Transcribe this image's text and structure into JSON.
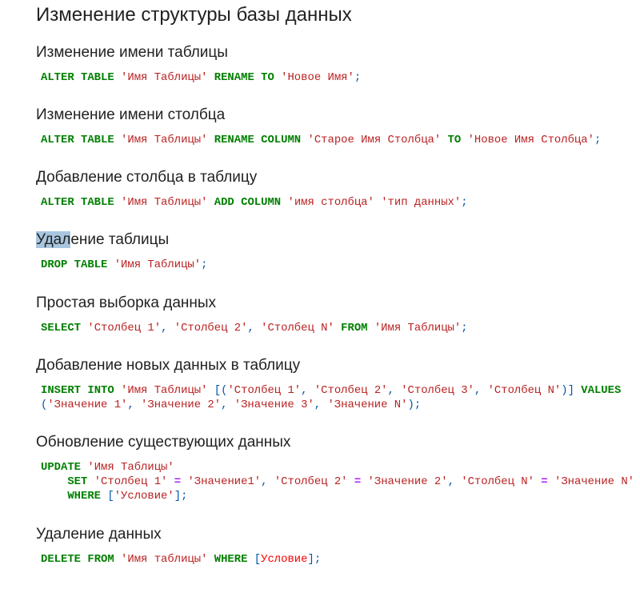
{
  "title": "Изменение структуры базы данных",
  "sections": [
    {
      "heading": "Изменение имени таблицы",
      "code": [
        [
          [
            "k",
            "ALTER TABLE"
          ],
          [
            "p",
            " "
          ],
          [
            "s",
            "'Имя Таблицы'"
          ],
          [
            "p",
            " "
          ],
          [
            "k",
            "RENAME"
          ],
          [
            "p",
            " "
          ],
          [
            "k",
            "TO"
          ],
          [
            "p",
            " "
          ],
          [
            "s",
            "'Новое Имя'"
          ],
          [
            "p",
            ";"
          ]
        ]
      ]
    },
    {
      "heading": "Изменение имени столбца",
      "code": [
        [
          [
            "k",
            "ALTER TABLE"
          ],
          [
            "p",
            " "
          ],
          [
            "s",
            "'Имя Таблицы'"
          ],
          [
            "p",
            " "
          ],
          [
            "k",
            "RENAME"
          ],
          [
            "p",
            " "
          ],
          [
            "k",
            "COLUMN"
          ],
          [
            "p",
            " "
          ],
          [
            "s",
            "'Старое Имя Столбца'"
          ],
          [
            "p",
            " "
          ],
          [
            "k",
            "TO"
          ],
          [
            "p",
            " "
          ],
          [
            "s",
            "'Новое Имя Столбца'"
          ],
          [
            "p",
            ";"
          ]
        ]
      ]
    },
    {
      "heading": "Добавление столбца в таблицу",
      "code": [
        [
          [
            "k",
            "ALTER TABLE"
          ],
          [
            "p",
            " "
          ],
          [
            "s",
            "'Имя Таблицы'"
          ],
          [
            "p",
            " "
          ],
          [
            "k",
            "ADD"
          ],
          [
            "p",
            " "
          ],
          [
            "k",
            "COLUMN"
          ],
          [
            "p",
            " "
          ],
          [
            "s",
            "'имя столбца'"
          ],
          [
            "p",
            " "
          ],
          [
            "s",
            "'тип данных'"
          ],
          [
            "p",
            ";"
          ]
        ]
      ]
    },
    {
      "heading": "Удаление таблицы",
      "selected_text": "Удал",
      "code": [
        [
          [
            "k",
            "DROP TABLE"
          ],
          [
            "p",
            " "
          ],
          [
            "s",
            "'Имя Таблицы'"
          ],
          [
            "p",
            ";"
          ]
        ]
      ]
    },
    {
      "heading": "Простая выборка данных",
      "code": [
        [
          [
            "k",
            "SELECT"
          ],
          [
            "p",
            " "
          ],
          [
            "s",
            "'Столбец 1'"
          ],
          [
            "p",
            ", "
          ],
          [
            "s",
            "'Столбец 2'"
          ],
          [
            "p",
            ", "
          ],
          [
            "s",
            "'Столбец N'"
          ],
          [
            "p",
            " "
          ],
          [
            "k",
            "FROM"
          ],
          [
            "p",
            " "
          ],
          [
            "s",
            "'Имя Таблицы'"
          ],
          [
            "p",
            ";"
          ]
        ]
      ]
    },
    {
      "heading": "Добавление новых данных в таблицу",
      "code": [
        [
          [
            "k",
            "INSERT"
          ],
          [
            "p",
            " "
          ],
          [
            "k",
            "INTO"
          ],
          [
            "p",
            " "
          ],
          [
            "s",
            "'Имя Таблицы'"
          ],
          [
            "p",
            " [("
          ],
          [
            "s",
            "'Столбец 1'"
          ],
          [
            "p",
            ", "
          ],
          [
            "s",
            "'Столбец 2'"
          ],
          [
            "p",
            ", "
          ],
          [
            "s",
            "'Столбец 3'"
          ],
          [
            "p",
            ", "
          ],
          [
            "s",
            "'Столбец N'"
          ],
          [
            "p",
            ")] "
          ],
          [
            "k",
            "VALUES"
          ]
        ],
        [
          [
            "p",
            "("
          ],
          [
            "s",
            "'Значение 1'"
          ],
          [
            "p",
            ", "
          ],
          [
            "s",
            "'Значение 2'"
          ],
          [
            "p",
            ", "
          ],
          [
            "s",
            "'Значение 3'"
          ],
          [
            "p",
            ", "
          ],
          [
            "s",
            "'Значение N'"
          ],
          [
            "p",
            ");"
          ]
        ]
      ]
    },
    {
      "heading": "Обновление существующих данных",
      "code": [
        [
          [
            "k",
            "UPDATE"
          ],
          [
            "p",
            " "
          ],
          [
            "s",
            "'Имя Таблицы'"
          ]
        ],
        [
          [
            "p",
            "    "
          ],
          [
            "k",
            "SET"
          ],
          [
            "p",
            " "
          ],
          [
            "s",
            "'Столбец 1'"
          ],
          [
            "p",
            " "
          ],
          [
            "o",
            "="
          ],
          [
            "p",
            " "
          ],
          [
            "s",
            "'Значение1'"
          ],
          [
            "p",
            ", "
          ],
          [
            "s",
            "'Столбец 2'"
          ],
          [
            "p",
            " "
          ],
          [
            "o",
            "="
          ],
          [
            "p",
            " "
          ],
          [
            "s",
            "'Значение 2'"
          ],
          [
            "p",
            ", "
          ],
          [
            "s",
            "'Столбец N'"
          ],
          [
            "p",
            " "
          ],
          [
            "o",
            "="
          ],
          [
            "p",
            " "
          ],
          [
            "s",
            "'Значение N'"
          ]
        ],
        [
          [
            "p",
            "    "
          ],
          [
            "k",
            "WHERE"
          ],
          [
            "p",
            " ["
          ],
          [
            "s",
            "'Условие'"
          ],
          [
            "p",
            "];"
          ]
        ]
      ]
    },
    {
      "heading": "Удаление данных",
      "code": [
        [
          [
            "k",
            "DELETE"
          ],
          [
            "p",
            " "
          ],
          [
            "k",
            "FROM"
          ],
          [
            "p",
            " "
          ],
          [
            "s",
            "'Имя таблицы'"
          ],
          [
            "p",
            " "
          ],
          [
            "k",
            "WHERE"
          ],
          [
            "p",
            " ["
          ],
          [
            "e",
            "Условие"
          ],
          [
            "p",
            "];"
          ]
        ]
      ]
    }
  ],
  "colors": {
    "keyword": "#008000",
    "string": "#ba2121",
    "punctuation": "#0055aa",
    "operator": "#aa22ff",
    "error": "#ff0000",
    "selection": "#a8c6df"
  }
}
